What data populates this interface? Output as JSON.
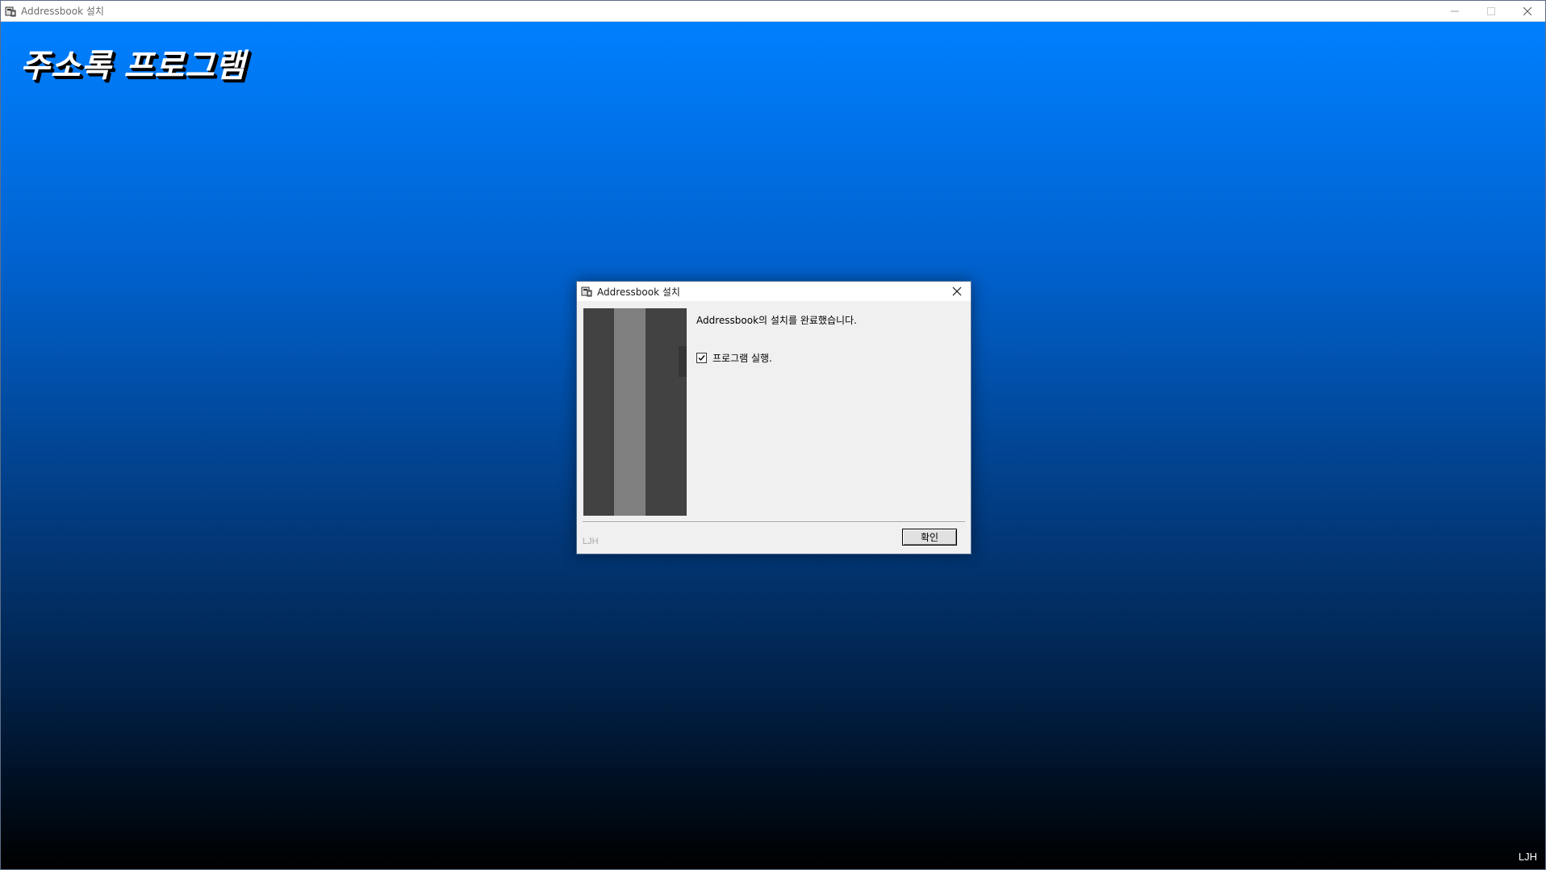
{
  "window": {
    "title": "Addressbook 설치",
    "controls": {
      "minimize": "minimize-icon",
      "maximize": "maximize-icon",
      "close": "close-icon"
    }
  },
  "background": {
    "banner": "주소록 프로그램",
    "corner_label": "LJH",
    "colors": {
      "top": "#0080ff",
      "bottom": "#000000"
    }
  },
  "dialog": {
    "title": "Addressbook 설치",
    "message": "Addressbook의 설치를 완료했습니다.",
    "checkbox": {
      "label": "프로그램 실행.",
      "checked": true
    },
    "brand": "LJH",
    "ok_button": "확인"
  }
}
